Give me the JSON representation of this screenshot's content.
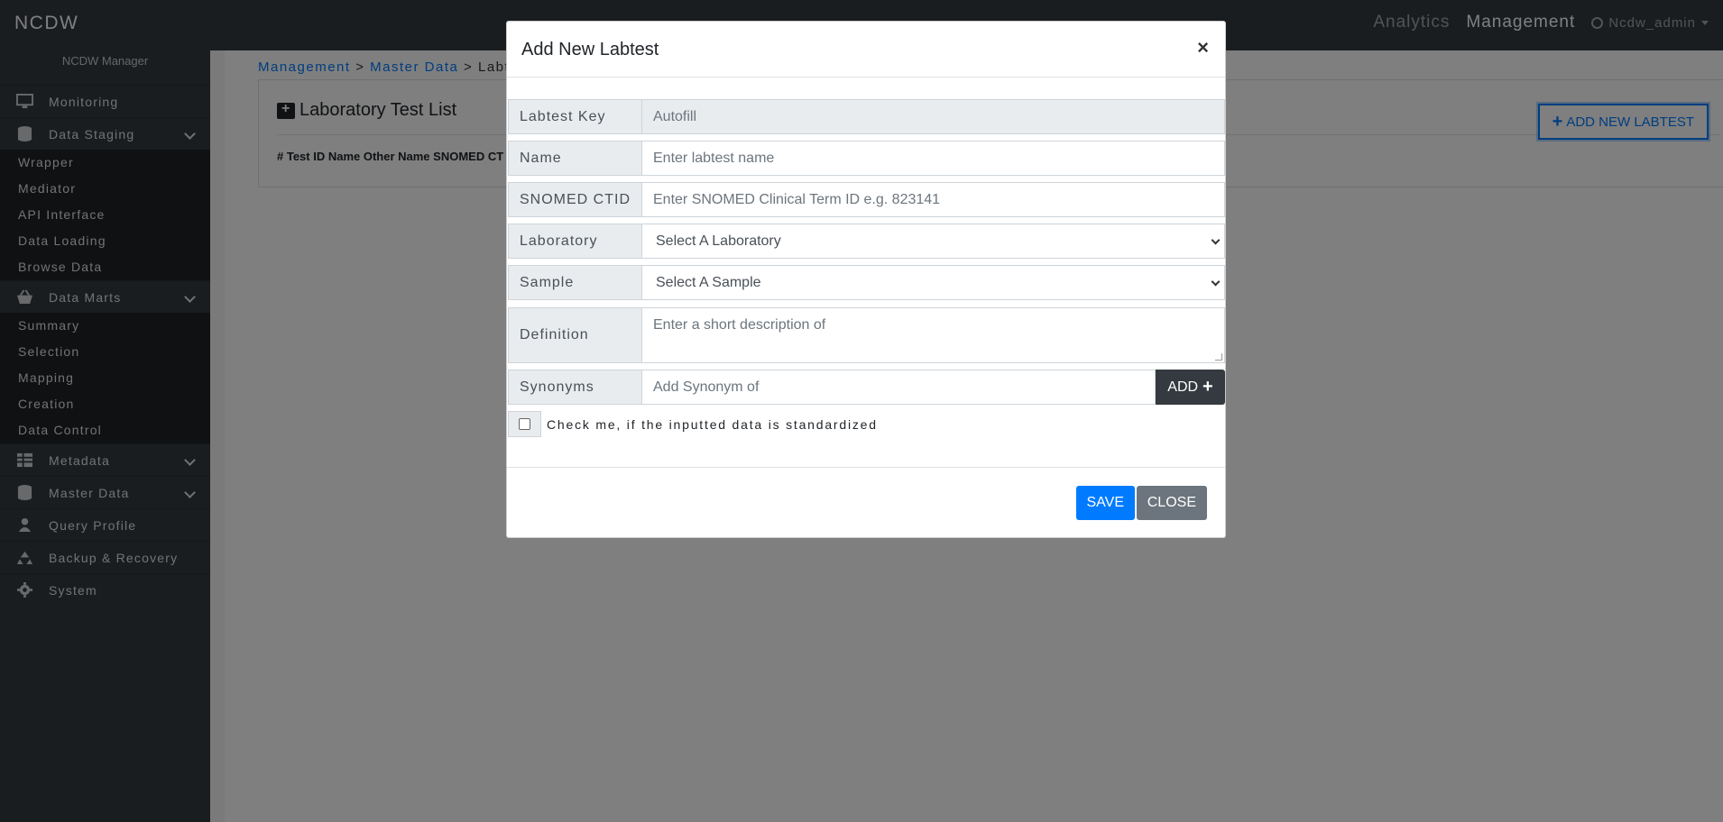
{
  "navbar": {
    "brand": "NCDW",
    "links": [
      "Analytics",
      "Management"
    ],
    "user": "Ncdw_admin"
  },
  "sidebar": {
    "subtitle": "NCDW Manager",
    "monitoring": "Monitoring",
    "data_staging": {
      "label": "Data Staging",
      "items": [
        "Wrapper",
        "Mediator",
        "API Interface",
        "Data Loading",
        "Browse Data"
      ]
    },
    "data_marts": {
      "label": "Data Marts",
      "items": [
        "Summary",
        "Selection",
        "Mapping",
        "Creation",
        "Data Control"
      ]
    },
    "metadata": "Metadata",
    "master_data": "Master Data",
    "query_profile": "Query Profile",
    "backup_recovery": "Backup & Recovery",
    "system": "System"
  },
  "breadcrumb": {
    "management": "Management",
    "master_data": "Master Data",
    "current": "Labtes",
    "separator": ">"
  },
  "card": {
    "title": "Laboratory Test List",
    "table_headers": "# Test ID Name Other Name SNOMED CT",
    "add_button": "ADD NEW LABTEST"
  },
  "modal": {
    "title": "Add New Labtest",
    "close_symbol": "×",
    "fields": {
      "labtest_key": {
        "label": "Labtest Key",
        "placeholder": "Autofill"
      },
      "name": {
        "label": "Name",
        "placeholder": "Enter labtest name"
      },
      "snomed": {
        "label": "SNOMED CTID",
        "placeholder": "Enter SNOMED Clinical Term ID e.g. 823141"
      },
      "laboratory": {
        "label": "Laboratory",
        "value": "Select A Laboratory"
      },
      "sample": {
        "label": "Sample",
        "value": "Select A Sample"
      },
      "definition": {
        "label": "Definition",
        "placeholder": "Enter a short description of"
      },
      "synonyms": {
        "label": "Synonyms",
        "placeholder": "Add Synonym of",
        "button": "ADD"
      }
    },
    "checkbox_label": "Check me, if the inputted data is standardized",
    "save": "SAVE",
    "close": "CLOSE"
  }
}
